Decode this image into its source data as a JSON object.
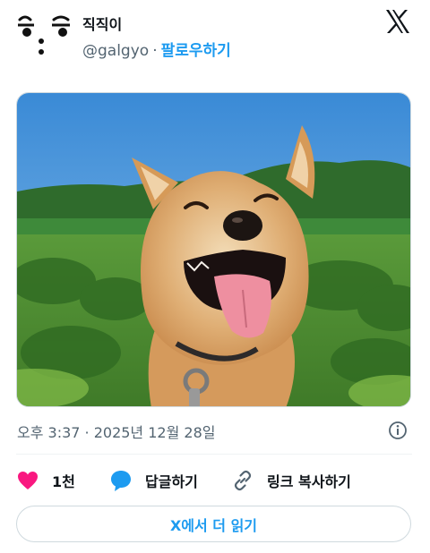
{
  "author": {
    "display_name": "직직이",
    "handle": "@galgyo",
    "separator": "·",
    "follow_label": "팔로우하기"
  },
  "brand": {
    "logo_icon": "x-logo-icon"
  },
  "media": {
    "subject": "smiling shiba inu photo"
  },
  "meta": {
    "timestamp": "오후 3:37 · 2025년 12월 28일"
  },
  "actions": {
    "like_count": "1천",
    "reply_label": "답글하기",
    "copy_link_label": "링크 복사하기"
  },
  "footer": {
    "read_more_label": "X에서 더 읽기"
  },
  "colors": {
    "accent": "#1d9bf0",
    "like": "#f91880",
    "text": "#0f1419",
    "muted": "#536471"
  }
}
